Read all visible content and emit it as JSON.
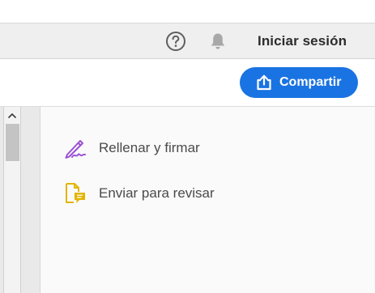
{
  "header": {
    "help_icon": "question-circle-icon",
    "notifications_icon": "bell-icon",
    "signin_label": "Iniciar sesión"
  },
  "toolbar": {
    "share_label": "Compartir",
    "share_icon": "share-upload-icon",
    "share_color": "#1a73e2"
  },
  "tools": [
    {
      "label": "Rellenar y firmar",
      "icon": "fill-sign-pen-icon",
      "color": "#9b4fd6"
    },
    {
      "label": "Enviar para revisar",
      "icon": "send-review-document-icon",
      "color": "#e3b400"
    }
  ],
  "scrollbar": {
    "up_icon": "scroll-up-arrow-icon"
  }
}
